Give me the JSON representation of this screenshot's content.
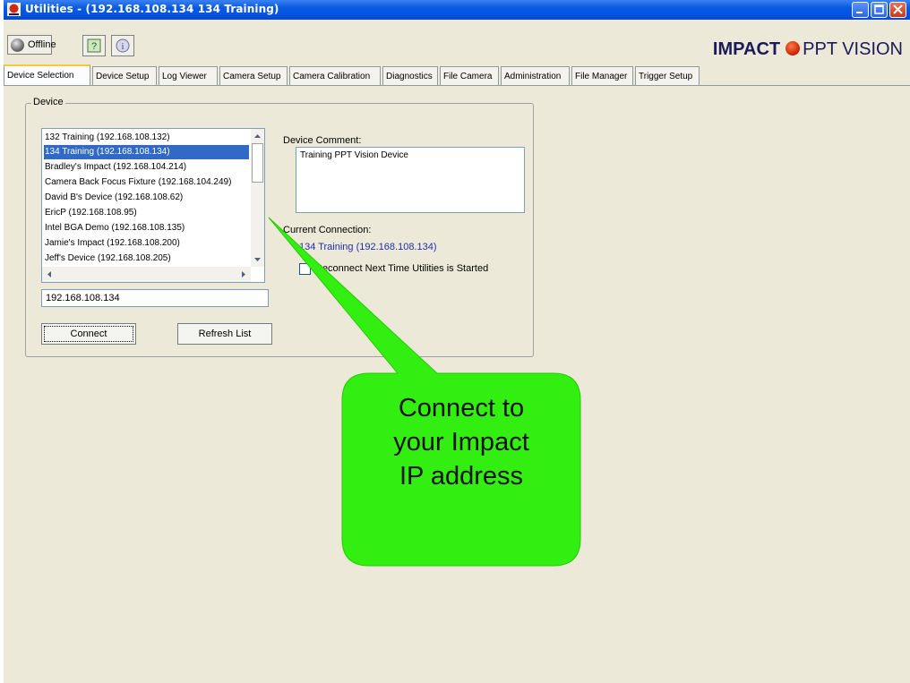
{
  "window": {
    "title": "Utilities - (192.168.108.134    134 Training)"
  },
  "toolbar": {
    "offline_label": "Offline",
    "help_icon": "help-icon",
    "info_icon": "info-icon",
    "brand_impact": "IMPACT",
    "brand_ppt": "PPT VISION"
  },
  "tabs": [
    {
      "label": "Device Selection"
    },
    {
      "label": "Device Setup"
    },
    {
      "label": "Log Viewer"
    },
    {
      "label": "Camera Setup"
    },
    {
      "label": "Camera Calibration"
    },
    {
      "label": "Diagnostics"
    },
    {
      "label": "File Camera"
    },
    {
      "label": "Administration"
    },
    {
      "label": "File Manager"
    },
    {
      "label": "Trigger Setup"
    }
  ],
  "device_group": {
    "label": "Device",
    "devices": [
      {
        "label": "132 Training  (192.168.108.132)"
      },
      {
        "label": "134 Training  (192.168.108.134)"
      },
      {
        "label": "Bradley's Impact  (192.168.104.214)"
      },
      {
        "label": "Camera Back Focus Fixture  (192.168.104.249)"
      },
      {
        "label": "David B's Device  (192.168.108.62)"
      },
      {
        "label": "EricP  (192.168.108.95)"
      },
      {
        "label": "Intel BGA Demo  (192.168.108.135)"
      },
      {
        "label": "Jamie's Impact  (192.168.108.200)"
      },
      {
        "label": "Jeff's Device  (192.168.108.205)"
      }
    ],
    "ip_value": "192.168.108.134",
    "connect_label": "Connect",
    "refresh_label": "Refresh List",
    "comment_label": "Device Comment:",
    "comment_value": "Training PPT Vision Device",
    "connection_label": "Current Connection:",
    "connection_value": "134 Training  (192.168.108.134)",
    "reconnect_label": "Reconnect Next Time Utilities is Started"
  },
  "callout": {
    "line1": "Connect to",
    "line2": "your Impact",
    "line3": "IP address",
    "color": "#33ee11"
  }
}
